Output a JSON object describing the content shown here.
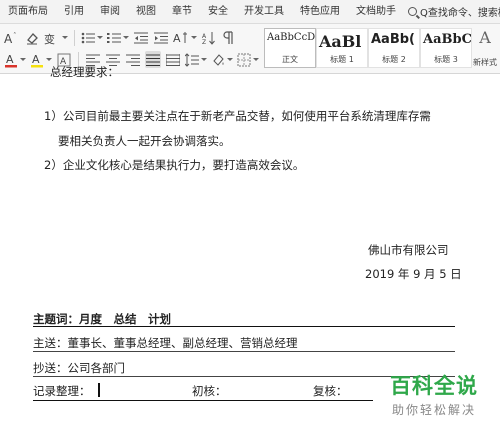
{
  "menubar": {
    "tabs": [
      "页面布局",
      "引用",
      "审阅",
      "视图",
      "章节",
      "安全",
      "开发工具",
      "特色应用",
      "文档助手"
    ],
    "search": "Q查找命令、搜索模板"
  },
  "toolbar": {
    "styles": [
      {
        "sample": "AaBbCcDd",
        "name": "正文"
      },
      {
        "sample": "AaBl",
        "name": "标题 1"
      },
      {
        "sample": "AaBb(",
        "name": "标题 2"
      },
      {
        "sample": "AaBbC",
        "name": "标题 3"
      }
    ],
    "new_style": {
      "glyph": "A",
      "name": "新样式"
    },
    "font_color_hex": "#d9342b",
    "highlight_hex": "#f6e10f"
  },
  "document": {
    "line1": "总经理要求：",
    "item1a": "1）公司目前最主要关注点在于新老产品交替，如何使用平台系统清理库存需",
    "item1b": "要相关负责人一起开会协调落实。",
    "item2": "2）企业文化核心是结果执行力，要打造高效会议。",
    "company": "佛山市有限公司",
    "date": "2019 年 9 月 5 日",
    "subject": "主题词：月度　总结　计划",
    "to": "主送：董事长、董事总经理、副总经理、营销总经理",
    "cc": "抄送：公司各部门",
    "recorder": "记录整理：",
    "review": "初核：",
    "recheck": "复核："
  },
  "watermark": {
    "big": "百科全说",
    "small": "助你轻松解决",
    "color": "#2fa84a"
  }
}
